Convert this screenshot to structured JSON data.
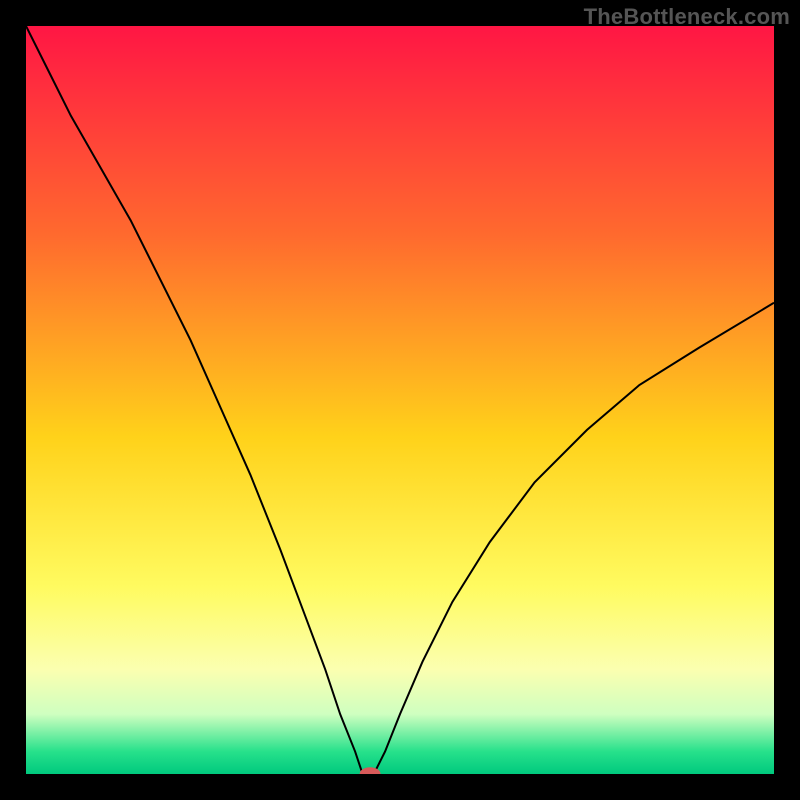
{
  "watermark": "TheBottleneck.com",
  "chart_data": {
    "type": "line",
    "title": "",
    "xlabel": "",
    "ylabel": "",
    "xlim": [
      0,
      100
    ],
    "ylim": [
      0,
      100
    ],
    "grid": false,
    "background_gradient_stops": [
      {
        "offset": 0,
        "color": "#ff1644"
      },
      {
        "offset": 28,
        "color": "#ff6a2e"
      },
      {
        "offset": 55,
        "color": "#ffd21a"
      },
      {
        "offset": 75,
        "color": "#fffb60"
      },
      {
        "offset": 86,
        "color": "#fbffb0"
      },
      {
        "offset": 92,
        "color": "#cfffc0"
      },
      {
        "offset": 97,
        "color": "#27e18b"
      },
      {
        "offset": 100,
        "color": "#00c97e"
      }
    ],
    "series": [
      {
        "name": "bottleneck-curve",
        "color": "#000000",
        "x": [
          0,
          3,
          6,
          10,
          14,
          18,
          22,
          26,
          30,
          34,
          37,
          40,
          42,
          44,
          45,
          45.5,
          46.5,
          48,
          50,
          53,
          57,
          62,
          68,
          75,
          82,
          90,
          100
        ],
        "y": [
          100,
          94,
          88,
          81,
          74,
          66,
          58,
          49,
          40,
          30,
          22,
          14,
          8,
          3,
          0,
          0,
          0,
          3,
          8,
          15,
          23,
          31,
          39,
          46,
          52,
          57,
          63
        ]
      }
    ],
    "marker": {
      "name": "optimal-point",
      "x": 46,
      "y": 0,
      "rx": 1.4,
      "ry": 0.9,
      "fill": "#d85a5a"
    }
  }
}
